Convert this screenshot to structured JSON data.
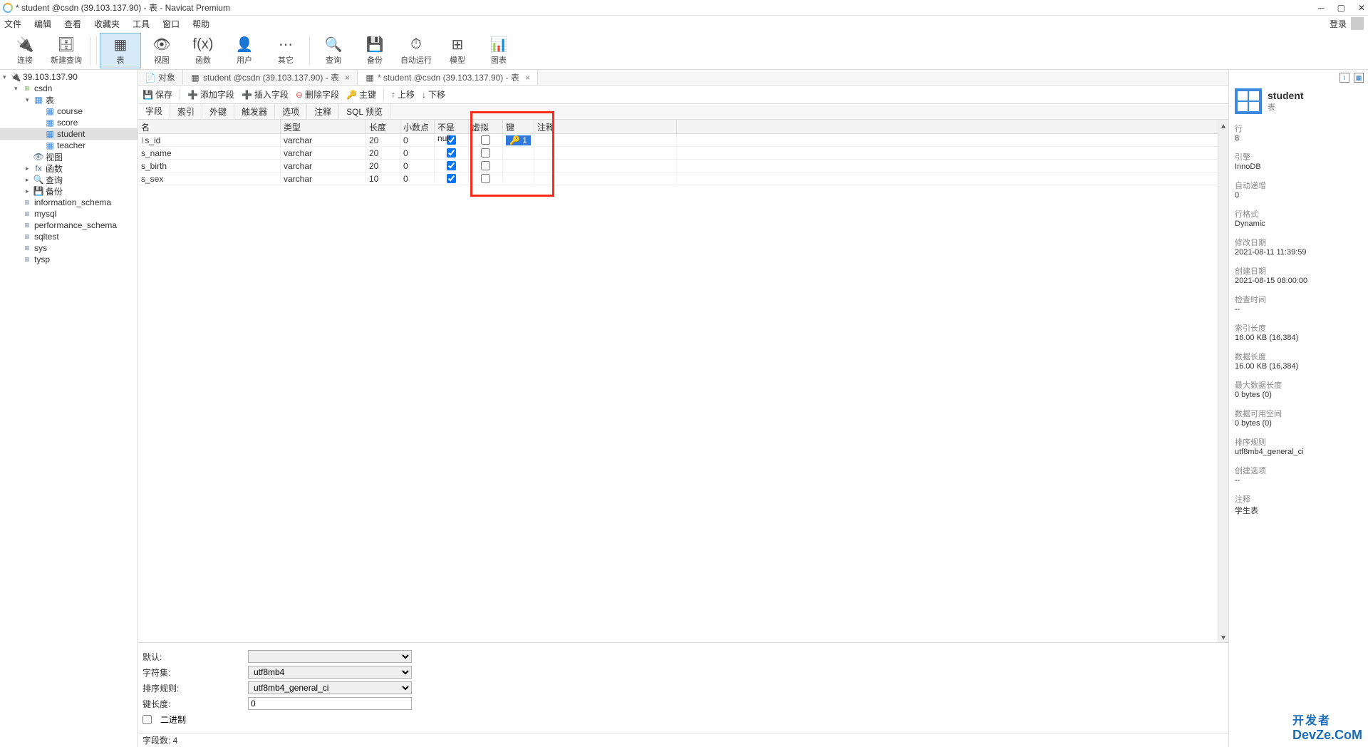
{
  "window": {
    "title": "* student @csdn (39.103.137.90) - 表 - Navicat Premium"
  },
  "menubar": {
    "items": [
      "文件",
      "编辑",
      "查看",
      "收藏夹",
      "工具",
      "窗口",
      "帮助"
    ],
    "login": "登录"
  },
  "toolbar": {
    "items": [
      {
        "label": "连接",
        "icon": "🔌"
      },
      {
        "label": "新建查询",
        "icon": "🗄"
      },
      {
        "label": "表",
        "icon": "▦",
        "active": true
      },
      {
        "label": "视图",
        "icon": "👁"
      },
      {
        "label": "函数",
        "icon": "f(x)"
      },
      {
        "label": "用户",
        "icon": "👤"
      },
      {
        "label": "其它",
        "icon": "⋯"
      },
      {
        "label": "查询",
        "icon": "🔍"
      },
      {
        "label": "备份",
        "icon": "💾"
      },
      {
        "label": "自动运行",
        "icon": "⏱"
      },
      {
        "label": "模型",
        "icon": "⊞"
      },
      {
        "label": "图表",
        "icon": "📊"
      }
    ]
  },
  "tree": [
    {
      "indent": 0,
      "arrow": "▾",
      "icon": "🔌",
      "label": "39.103.137.90",
      "cls": "icon-db"
    },
    {
      "indent": 1,
      "arrow": "▾",
      "icon": "≡",
      "label": "csdn",
      "cls": "icon-db"
    },
    {
      "indent": 2,
      "arrow": "▾",
      "icon": "▦",
      "label": "表",
      "cls": "icon-table"
    },
    {
      "indent": 3,
      "arrow": "",
      "icon": "▦",
      "label": "course",
      "cls": "icon-table"
    },
    {
      "indent": 3,
      "arrow": "",
      "icon": "▦",
      "label": "score",
      "cls": "icon-table"
    },
    {
      "indent": 3,
      "arrow": "",
      "icon": "▦",
      "label": "student",
      "cls": "icon-table",
      "sel": true
    },
    {
      "indent": 3,
      "arrow": "",
      "icon": "▦",
      "label": "teacher",
      "cls": "icon-table"
    },
    {
      "indent": 2,
      "arrow": "",
      "icon": "👁",
      "label": "视图",
      "cls": "icon-folder"
    },
    {
      "indent": 2,
      "arrow": "▸",
      "icon": "fx",
      "label": "函数",
      "cls": "icon-folder"
    },
    {
      "indent": 2,
      "arrow": "▸",
      "icon": "🔍",
      "label": "查询",
      "cls": "icon-folder"
    },
    {
      "indent": 2,
      "arrow": "▸",
      "icon": "💾",
      "label": "备份",
      "cls": "icon-folder"
    },
    {
      "indent": 1,
      "arrow": "",
      "icon": "≡",
      "label": "information_schema",
      "cls": "icon-folder"
    },
    {
      "indent": 1,
      "arrow": "",
      "icon": "≡",
      "label": "mysql",
      "cls": "icon-folder"
    },
    {
      "indent": 1,
      "arrow": "",
      "icon": "≡",
      "label": "performance_schema",
      "cls": "icon-folder"
    },
    {
      "indent": 1,
      "arrow": "",
      "icon": "≡",
      "label": "sqltest",
      "cls": "icon-folder"
    },
    {
      "indent": 1,
      "arrow": "",
      "icon": "≡",
      "label": "sys",
      "cls": "icon-folder"
    },
    {
      "indent": 1,
      "arrow": "",
      "icon": "≡",
      "label": "tysp",
      "cls": "icon-folder"
    }
  ],
  "tabs": [
    {
      "icon": "📄",
      "label": "对象",
      "active": false,
      "close": false
    },
    {
      "icon": "▦",
      "label": "student @csdn (39.103.137.90) - 表",
      "active": false,
      "close": true
    },
    {
      "icon": "▦",
      "label": "* student @csdn (39.103.137.90) - 表",
      "active": true,
      "close": true
    }
  ],
  "subtoolbar": [
    {
      "icon": "💾",
      "label": "保存",
      "color": "#1b6db8"
    },
    {
      "icon": "➕",
      "label": "添加字段",
      "color": "#2a9b3c"
    },
    {
      "icon": "➕",
      "label": "插入字段",
      "color": "#2a9b3c"
    },
    {
      "icon": "⊖",
      "label": "删除字段",
      "color": "#d9534f"
    },
    {
      "icon": "🔑",
      "label": "主键",
      "color": "#d48b1e"
    },
    {
      "icon": "↑",
      "label": "上移",
      "color": "#555"
    },
    {
      "icon": "↓",
      "label": "下移",
      "color": "#555"
    }
  ],
  "design_tabs": [
    "字段",
    "索引",
    "外键",
    "触发器",
    "选项",
    "注释",
    "SQL 预览"
  ],
  "grid": {
    "headers": [
      "名",
      "类型",
      "长度",
      "小数点",
      "不是 null",
      "虚拟",
      "键",
      "注释"
    ],
    "rows": [
      {
        "name": "s_id",
        "prefix": "I",
        "type": "varchar",
        "len": "20",
        "dec": "0",
        "notnull": true,
        "virtual": false,
        "key": "1",
        "sel": true
      },
      {
        "name": "s_name",
        "type": "varchar",
        "len": "20",
        "dec": "0",
        "notnull": true,
        "virtual": false
      },
      {
        "name": "s_birth",
        "type": "varchar",
        "len": "20",
        "dec": "0",
        "notnull": true,
        "virtual": false
      },
      {
        "name": "s_sex",
        "type": "varchar",
        "len": "10",
        "dec": "0",
        "notnull": true,
        "virtual": false
      }
    ]
  },
  "props": {
    "default_label": "默认:",
    "charset_label": "字符集:",
    "charset": "utf8mb4",
    "collation_label": "排序规则:",
    "collation": "utf8mb4_general_ci",
    "keylen_label": "键长度:",
    "keylen": "0",
    "binary_label": "二进制"
  },
  "status": {
    "field_count_label": "字段数: 4"
  },
  "right": {
    "title": "student",
    "sub": "表",
    "items": [
      {
        "l": "行",
        "v": "8"
      },
      {
        "l": "引擎",
        "v": "InnoDB"
      },
      {
        "l": "自动递增",
        "v": "0"
      },
      {
        "l": "行格式",
        "v": "Dynamic"
      },
      {
        "l": "修改日期",
        "v": "2021-08-11 11:39:59"
      },
      {
        "l": "创建日期",
        "v": "2021-08-15 08:00:00"
      },
      {
        "l": "检查时间",
        "v": "--"
      },
      {
        "l": "索引长度",
        "v": "16.00 KB (16,384)"
      },
      {
        "l": "数据长度",
        "v": "16.00 KB (16,384)"
      },
      {
        "l": "最大数据长度",
        "v": "0 bytes (0)"
      },
      {
        "l": "数据可用空间",
        "v": "0 bytes (0)"
      },
      {
        "l": "排序规则",
        "v": "utf8mb4_general_ci"
      },
      {
        "l": "创建选项",
        "v": "--"
      },
      {
        "l": "注释",
        "v": "学生表"
      }
    ]
  },
  "watermark": {
    "l1": "开发者",
    "l2": "DevZe.CoM"
  }
}
